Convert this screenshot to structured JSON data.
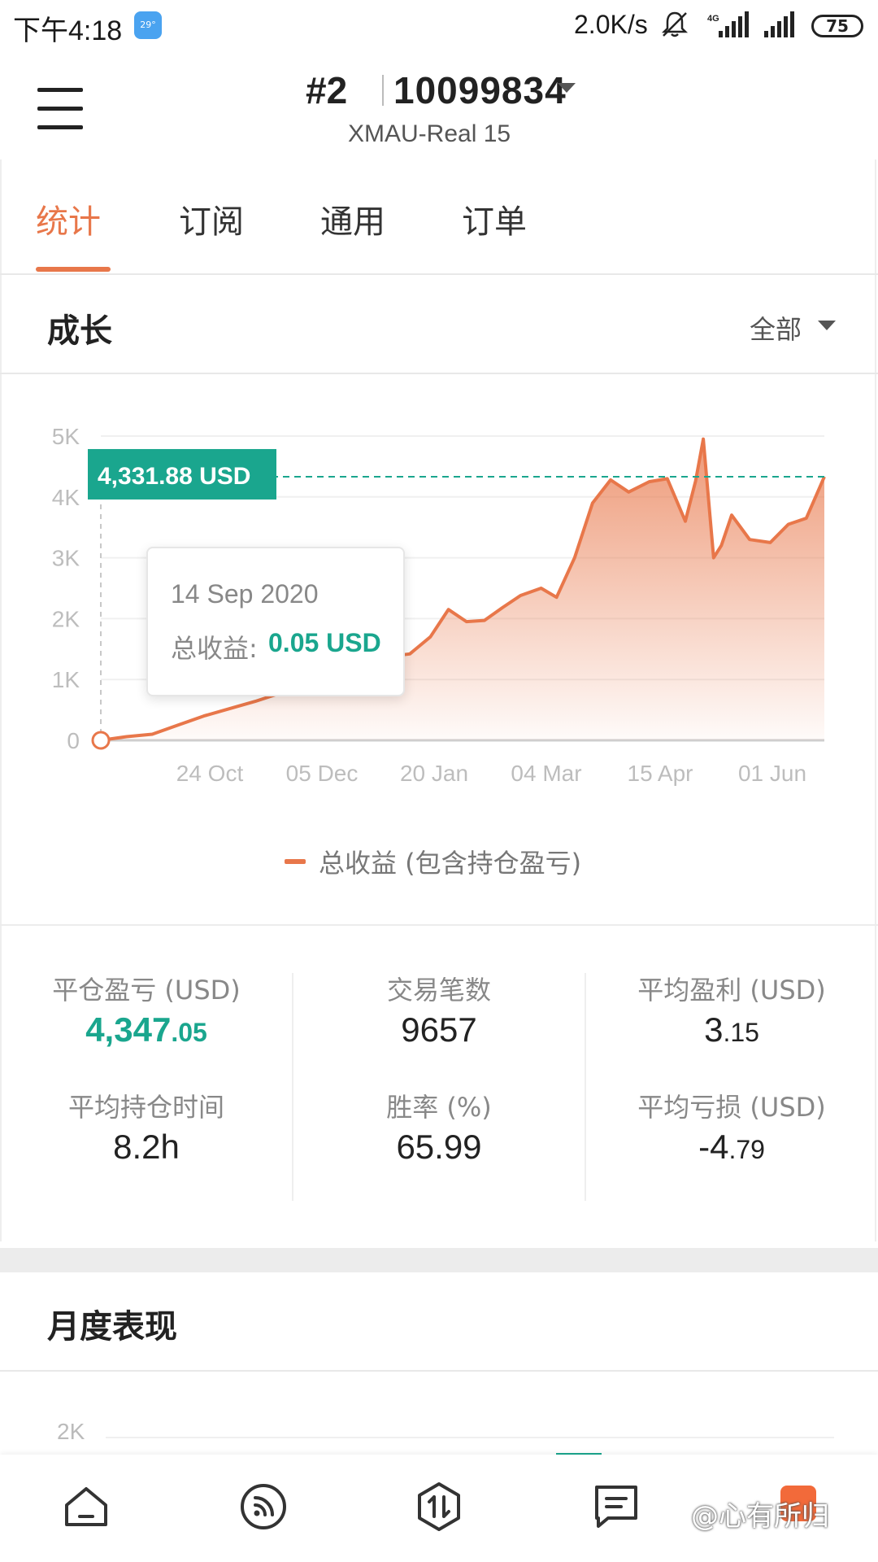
{
  "status_bar": {
    "time": "下午4:18",
    "weather_temp": "29°",
    "net_speed": "2.0K/s",
    "network_type": "4G",
    "battery": "75"
  },
  "header": {
    "account_prefix": "#2",
    "account_id": "10099834",
    "server": "XMAU-Real 15"
  },
  "tabs": [
    {
      "label": "统计",
      "active": true
    },
    {
      "label": "订阅",
      "active": false
    },
    {
      "label": "通用",
      "active": false
    },
    {
      "label": "订单",
      "active": false
    }
  ],
  "growth": {
    "title": "成长",
    "range": "全部",
    "current_value_label": "4,331.88 USD",
    "tooltip": {
      "date": "14 Sep 2020",
      "label": "总收益:",
      "value": "0.05 USD"
    },
    "legend": "总收益 (包含持仓盈亏)"
  },
  "chart_data": {
    "type": "area",
    "y_ticks": [
      "0",
      "1K",
      "2K",
      "3K",
      "4K",
      "5K"
    ],
    "x_ticks": [
      "24 Oct",
      "05 Dec",
      "20 Jan",
      "04 Mar",
      "15 Apr",
      "01 Jun"
    ],
    "ylim": [
      0,
      5000
    ],
    "reference_line": 4331.88,
    "series": [
      {
        "name": "总收益 (包含持仓盈亏)",
        "color": "#e8774a",
        "x": [
          "2020-09-14",
          "2020-09-24",
          "2020-10-04",
          "2020-10-14",
          "2020-10-24",
          "2020-11-03",
          "2020-11-13",
          "2020-11-23",
          "2020-12-05",
          "2020-12-15",
          "2020-12-25",
          "2021-01-04",
          "2021-01-12",
          "2021-01-20",
          "2021-01-27",
          "2021-02-03",
          "2021-02-10",
          "2021-02-17",
          "2021-02-24",
          "2021-03-04",
          "2021-03-10",
          "2021-03-17",
          "2021-03-24",
          "2021-03-31",
          "2021-04-07",
          "2021-04-15",
          "2021-04-22",
          "2021-04-29",
          "2021-05-03",
          "2021-05-06",
          "2021-05-10",
          "2021-05-13",
          "2021-05-17",
          "2021-05-24",
          "2021-06-01",
          "2021-06-08",
          "2021-06-15",
          "2021-06-22"
        ],
        "values": [
          0,
          60,
          100,
          250,
          400,
          520,
          640,
          780,
          900,
          1080,
          1250,
          1380,
          1420,
          1700,
          2150,
          1950,
          1970,
          2180,
          2380,
          2500,
          2350,
          3000,
          3900,
          4280,
          4080,
          4250,
          4300,
          3600,
          4260,
          4950,
          3000,
          3200,
          3700,
          3300,
          3250,
          3550,
          3650,
          4331.88
        ]
      }
    ]
  },
  "stats": [
    {
      "label": "平仓盈亏 (USD)",
      "int": "4,347",
      "dec": ".05",
      "highlight": true
    },
    {
      "label": "交易笔数",
      "int": "9657",
      "dec": "",
      "highlight": false
    },
    {
      "label": "平均盈利 (USD)",
      "int": "3",
      "dec": ".15",
      "highlight": false
    },
    {
      "label": "平均持仓时间",
      "int": "8.2h",
      "dec": "",
      "highlight": false
    },
    {
      "label": "胜率 (%)",
      "int": "65.99",
      "dec": "",
      "highlight": false
    },
    {
      "label": "平均亏损 (USD)",
      "int": "-4",
      "dec": ".79",
      "highlight": false
    }
  ],
  "monthly": {
    "title": "月度表现",
    "y_tick": "2K"
  },
  "bottom_nav": [
    {
      "icon": "home-icon"
    },
    {
      "icon": "feed-icon"
    },
    {
      "icon": "trade-icon"
    },
    {
      "icon": "message-icon"
    }
  ],
  "watermark": "@心有所归",
  "colors": {
    "accent": "#e8774a",
    "positive": "#1aa68e"
  }
}
